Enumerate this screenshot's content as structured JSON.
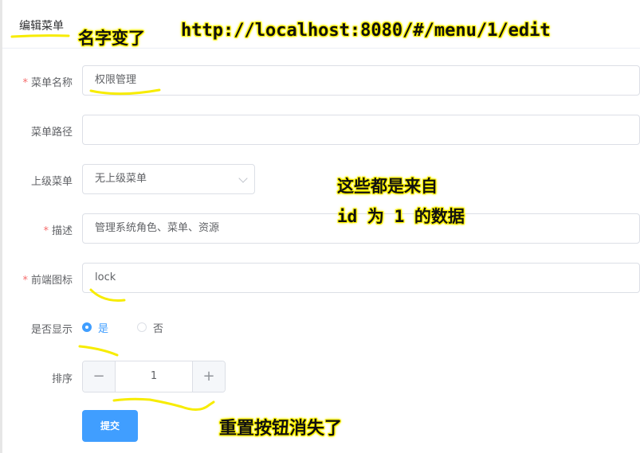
{
  "card": {
    "title": "编辑菜单"
  },
  "form": {
    "menu_name": {
      "label": "菜单名称",
      "required_mark": "*",
      "value": "权限管理"
    },
    "menu_path": {
      "label": "菜单路径",
      "value": ""
    },
    "parent_menu": {
      "label": "上级菜单",
      "value": "无上级菜单"
    },
    "description": {
      "label": "描述",
      "required_mark": "*",
      "value": "管理系统角色、菜单、资源"
    },
    "icon": {
      "label": "前端图标",
      "required_mark": "*",
      "value": "lock"
    },
    "visible": {
      "label": "是否显示",
      "options": [
        "是",
        "否"
      ],
      "selected": "是"
    },
    "sort": {
      "label": "排序",
      "value": "1",
      "minus": "−",
      "plus": "+"
    },
    "submit_label": "提交"
  },
  "annotations": {
    "name_changed": "名字变了",
    "url": "http://localhost:8080/#/menu/1/edit",
    "data_source_line1": "这些都是来自",
    "data_source_line2": "id 为 1 的数据",
    "reset_gone": "重置按钮消失了"
  },
  "colors": {
    "primary": "#409eff",
    "required": "#f56c6c",
    "highlight": "#fff200",
    "annotation_stroke": "#f7ec00"
  }
}
